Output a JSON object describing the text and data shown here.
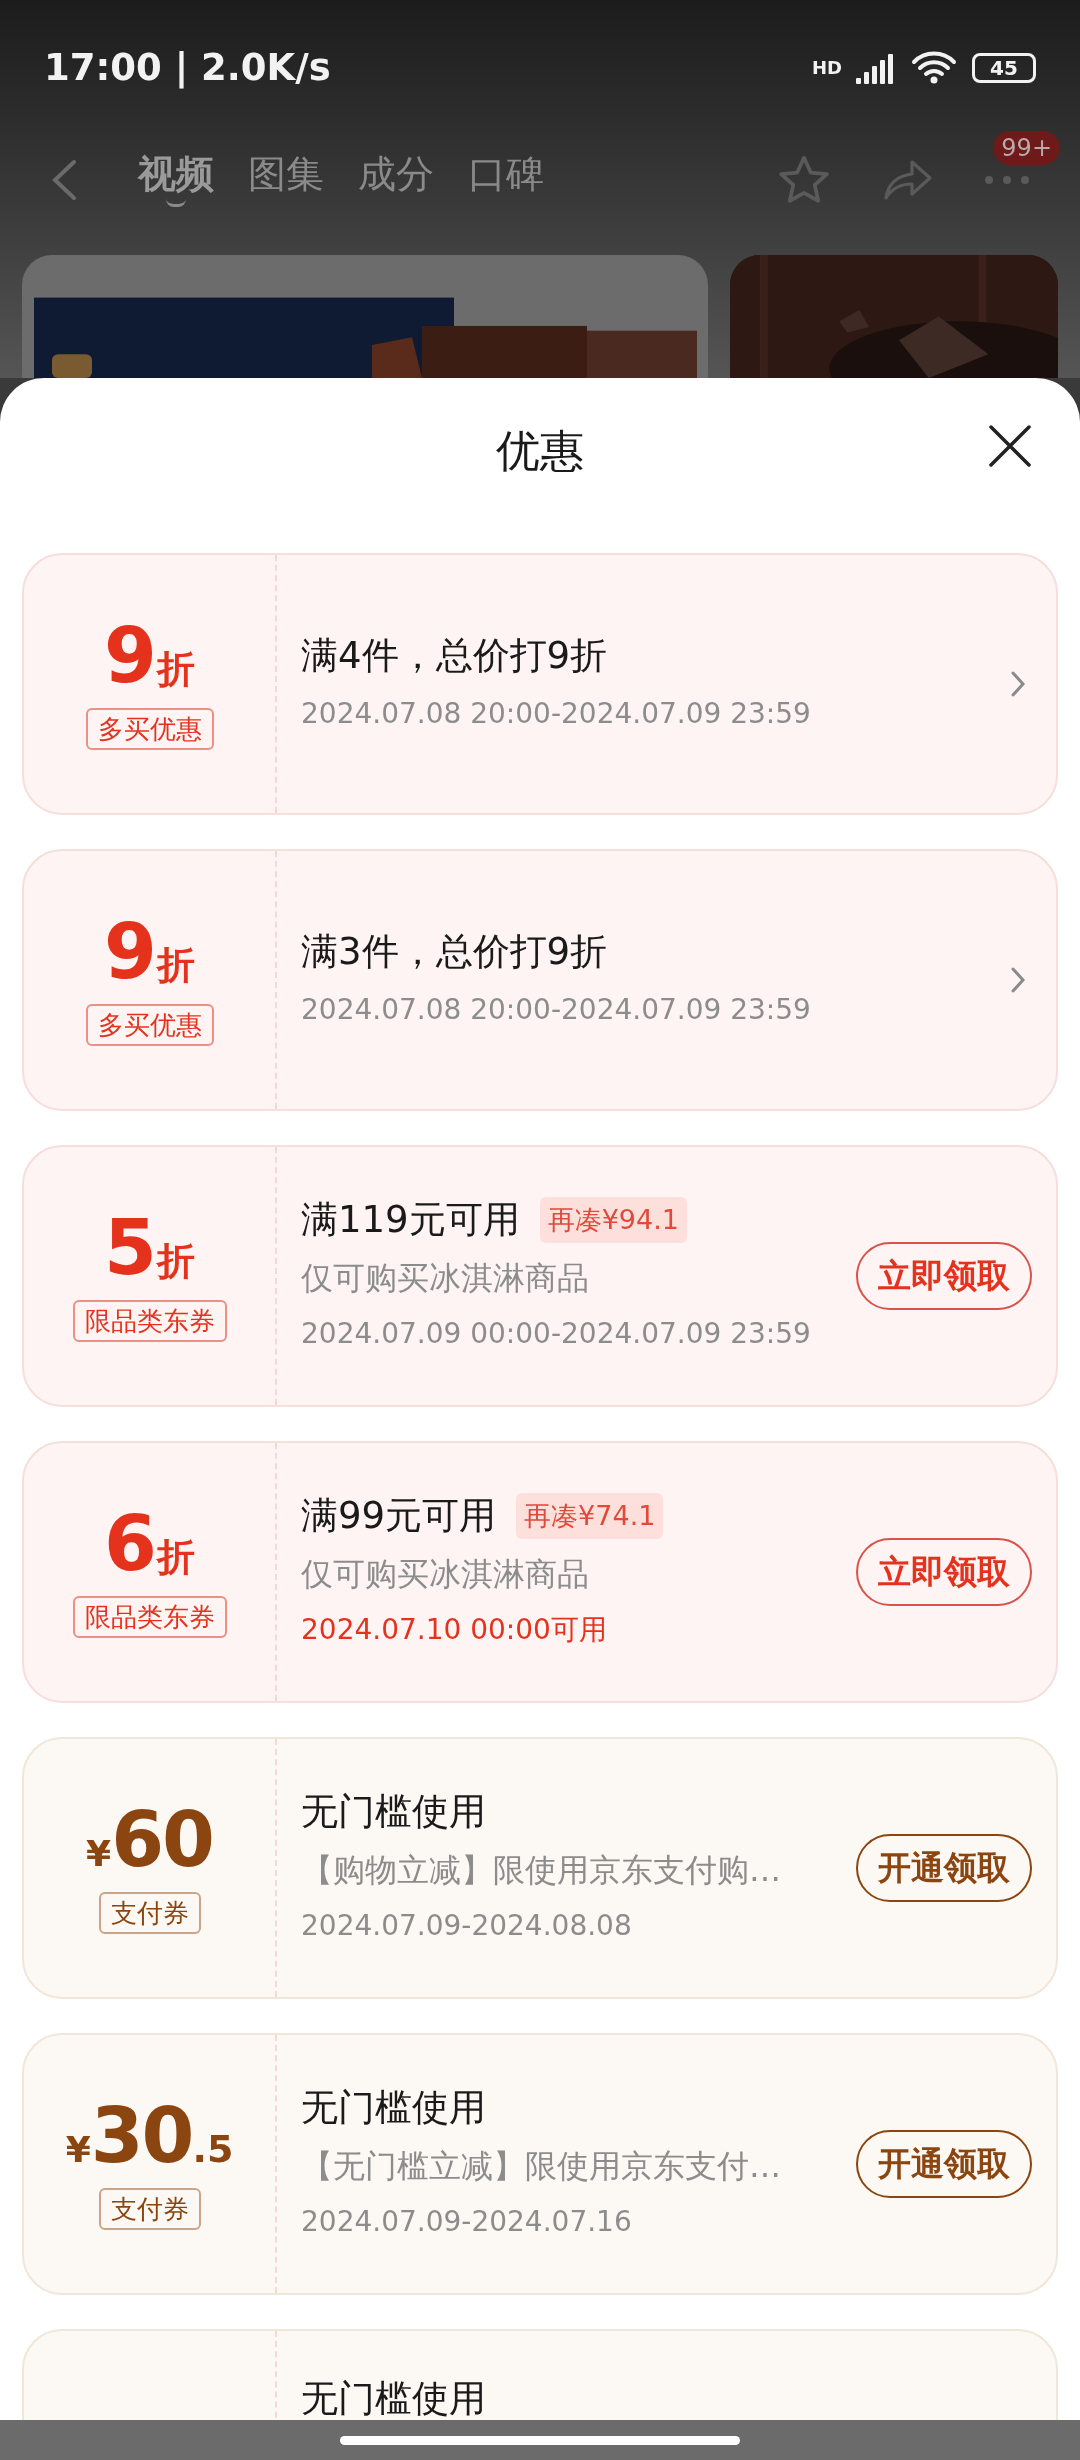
{
  "status_bar": {
    "time": "17:00 | 2.0K/s",
    "network": "HD",
    "battery": "45"
  },
  "nav": {
    "tabs": [
      {
        "label": "视频",
        "selected": true
      },
      {
        "label": "图集",
        "selected": false
      },
      {
        "label": "成分",
        "selected": false
      },
      {
        "label": "口碑",
        "selected": false
      }
    ],
    "badge": "99+"
  },
  "sheet": {
    "title": "优惠",
    "coupons": [
      {
        "kind": "discount",
        "amount": "9",
        "suffix": "折",
        "tag": "多买优惠",
        "title": "满4件，总价打9折",
        "date": "2024.07.08 20:00-2024.07.09 23:59",
        "upcoming": false,
        "action": {
          "kind": "chevron"
        }
      },
      {
        "kind": "discount",
        "amount": "9",
        "suffix": "折",
        "tag": "多买优惠",
        "title": "满3件，总价打9折",
        "date": "2024.07.08 20:00-2024.07.09 23:59",
        "upcoming": false,
        "action": {
          "kind": "chevron"
        }
      },
      {
        "kind": "discount",
        "amount": "5",
        "suffix": "折",
        "tag": "限品类东券",
        "title": "满119元可用",
        "note": "再凑¥94.1",
        "description": "仅可购买冰淇淋商品",
        "date": "2024.07.09 00:00-2024.07.09 23:59",
        "upcoming": false,
        "action": {
          "kind": "button",
          "label": "立即领取"
        }
      },
      {
        "kind": "discount",
        "amount": "6",
        "suffix": "折",
        "tag": "限品类东券",
        "title": "满99元可用",
        "note": "再凑¥74.1",
        "description": "仅可购买冰淇淋商品",
        "date": "2024.07.10 00:00可用",
        "upcoming": true,
        "action": {
          "kind": "button",
          "label": "立即领取"
        }
      },
      {
        "kind": "pay",
        "prefix": "¥",
        "amount": "60",
        "tag": "支付券",
        "title": "无门槛使用",
        "description": "【购物立减】限使用京东支付购…",
        "date": "2024.07.09-2024.08.08",
        "upcoming": false,
        "action": {
          "kind": "button",
          "label": "开通领取"
        }
      },
      {
        "kind": "pay",
        "prefix": "¥",
        "amount": "30",
        "suffix": ".5",
        "tag": "支付券",
        "title": "无门槛使用",
        "description": "【无门槛立减】限使用京东支付…",
        "date": "2024.07.09-2024.07.16",
        "upcoming": false,
        "action": {
          "kind": "button",
          "label": "开通领取"
        }
      },
      {
        "kind": "pay",
        "title": "无门槛使用"
      }
    ]
  }
}
